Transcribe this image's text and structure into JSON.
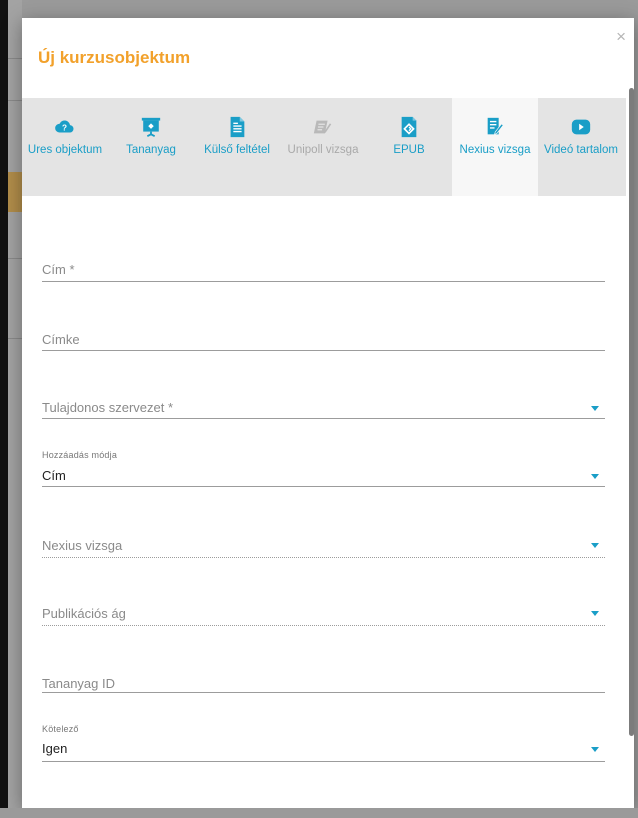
{
  "dialog": {
    "title": "Új kurzusobjektum",
    "close_label": "×"
  },
  "tabs": [
    {
      "label": "Ures objektum",
      "icon": "cloud-question-icon",
      "disabled": false,
      "active": false
    },
    {
      "label": "Tananyag",
      "icon": "presentation-board-icon",
      "disabled": false,
      "active": false
    },
    {
      "label": "Külső feltétel",
      "icon": "document-icon",
      "disabled": false,
      "active": false
    },
    {
      "label": "Unipoll vizsga",
      "icon": "card-pencil-icon",
      "disabled": true,
      "active": false
    },
    {
      "label": "EPUB",
      "icon": "epub-icon",
      "disabled": false,
      "active": false
    },
    {
      "label": "Nexius vizsga",
      "icon": "list-pencil-icon",
      "disabled": false,
      "active": true
    },
    {
      "label": "Videó tartalom",
      "icon": "play-icon",
      "disabled": false,
      "active": false
    }
  ],
  "form": {
    "cim": {
      "placeholder": "Cím *"
    },
    "cimke": {
      "placeholder": "Címke"
    },
    "tulajdonos": {
      "placeholder": "Tulajdonos szervezet *"
    },
    "hozzaadas": {
      "label": "Hozzáadás módja",
      "value": "Cím"
    },
    "nexius": {
      "placeholder": "Nexius vizsga"
    },
    "publikacios": {
      "placeholder": "Publikációs ág"
    },
    "tananyag_id": {
      "placeholder": "Tananyag ID"
    },
    "kotelezo": {
      "label": "Kötelező",
      "value": "Igen"
    }
  },
  "colors": {
    "title": "#f2a12b",
    "accent": "#1a9ec7",
    "disabled": "#a9a9a9"
  }
}
